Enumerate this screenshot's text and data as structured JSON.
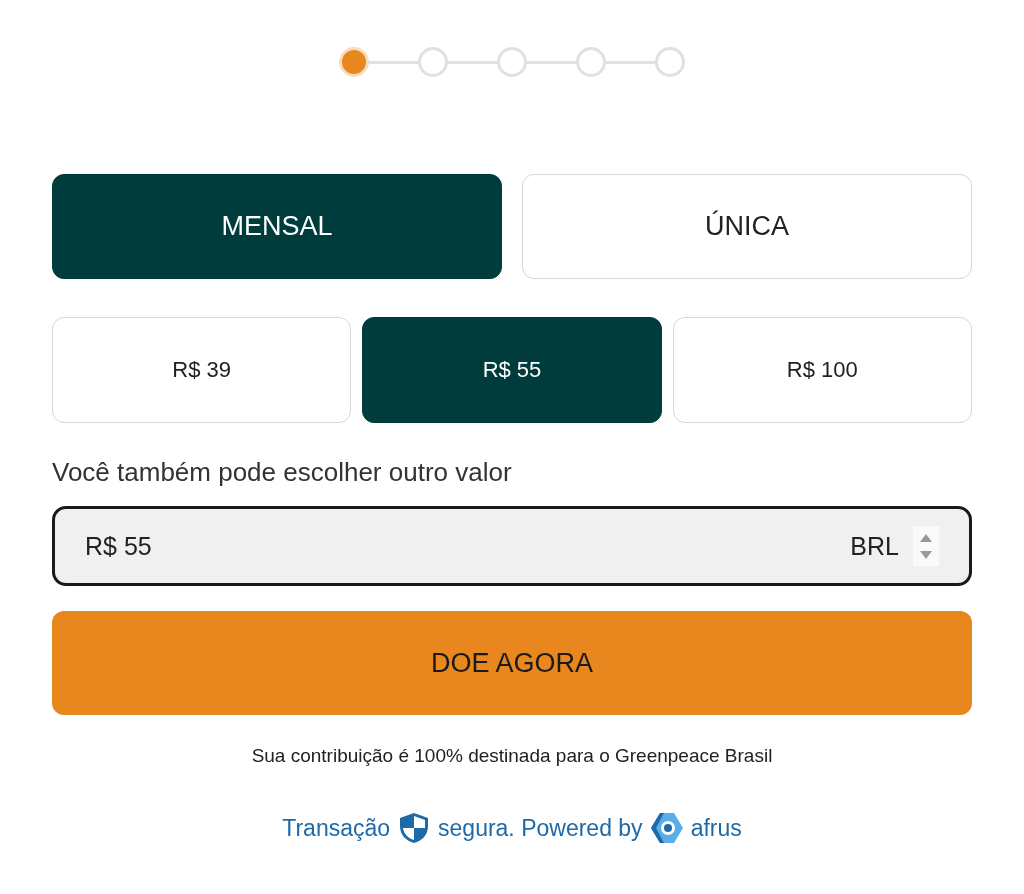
{
  "steps": [
    {
      "selected": true
    },
    {
      "selected": false
    },
    {
      "selected": false
    },
    {
      "selected": false
    },
    {
      "selected": false
    }
  ],
  "frequencies": [
    {
      "label": "MENSAL",
      "selected": true
    },
    {
      "label": "ÚNICA",
      "selected": false
    }
  ],
  "amounts": [
    {
      "label": "R$ 39",
      "selected": false
    },
    {
      "label": "R$ 55",
      "selected": true
    },
    {
      "label": "R$ 100",
      "selected": false
    }
  ],
  "custom_amount": {
    "label": "Você também pode escolher outro valor",
    "value": "R$ 55",
    "currency": "BRL"
  },
  "donate_button": "DOE AGORA",
  "note": "Sua contribuição é 100% destinada para o Greenpeace Brasil",
  "secure_line": {
    "before": "Transação",
    "middle": "segura. Powered by",
    "brand": "afrus"
  }
}
